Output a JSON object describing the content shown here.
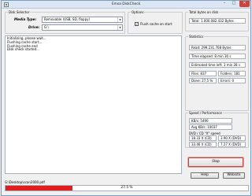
{
  "window": {
    "title": "Emsa DiskCheck"
  },
  "disk_selector": {
    "legend": "Disk Selector",
    "media_type_label": "Media Type:",
    "media_type_value": "Removable (USB, SD, floppy)",
    "drive_label": "Drive:",
    "drive_value": "G:\\"
  },
  "options": {
    "legend": "Options",
    "flush_cache_label": "Flush cache on start",
    "flush_cache_checked": "✓"
  },
  "total_bytes": {
    "legend": "Total bytes on disk",
    "value": "Total: 1.000.082.432 Bytes"
  },
  "statistics": {
    "legend": "Statistics",
    "read": "Read: 299.231.768 Bytes",
    "time_elapsed": "Time elapsed: 8 min 30 s",
    "estimated_time_left": "Estimated time left: 1 min 28 s",
    "files": "Files:  837",
    "folders": "Folders:  181",
    "done": "Done:  27,5 %",
    "errors": "Errors:  0"
  },
  "speed": {
    "legend": "Speed / Performance",
    "kbs": "KB/s: 5490",
    "avg_kbs": "Avg KB/s: 10037",
    "dvd_cd_label": "DVD / CD \"X\" speed",
    "dvd_cells": [
      "18.33 X (CD)",
      "3.90 X (DVD)",
      "33.46 X (CD)",
      "7.27 X (DVD)"
    ]
  },
  "log": {
    "lines": [
      "Initializing, please wait...",
      "Flushing cache start...",
      "Flushing cache end",
      "Disk check started..."
    ]
  },
  "buttons": {
    "stop": "Stop",
    "help": "Help",
    "website": "Website"
  },
  "current_file": "G:\\Desktop\\scan2000.pdf",
  "progress": {
    "fraction": 0.275,
    "label": "27.5 %"
  }
}
